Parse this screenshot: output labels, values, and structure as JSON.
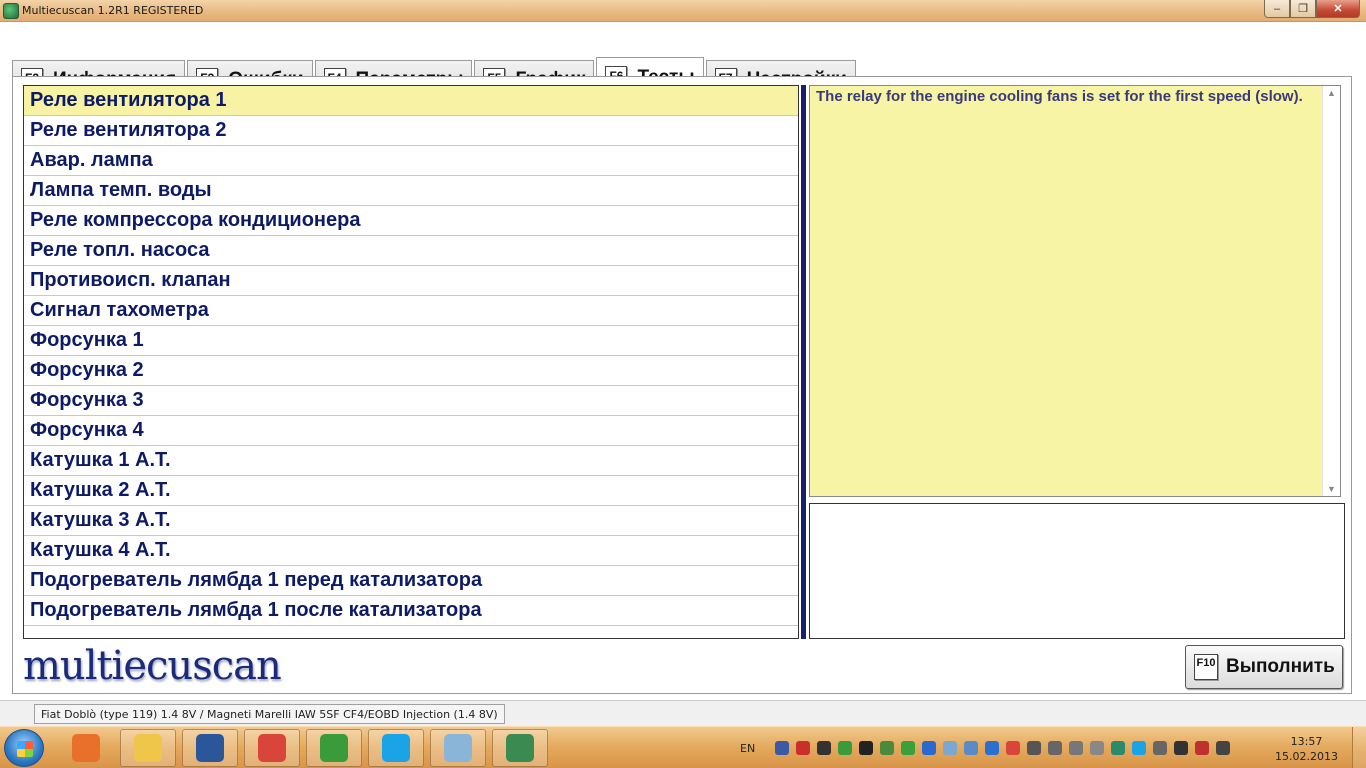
{
  "window": {
    "title": "Multiecuscan 1.2R1 REGISTERED",
    "min_glyph": "–",
    "max_glyph": "❐",
    "close_glyph": "✕"
  },
  "tabs": [
    {
      "fkey": "F2",
      "label": "Информация",
      "active": false
    },
    {
      "fkey": "F3",
      "label": "Ошибки",
      "active": false
    },
    {
      "fkey": "F4",
      "label": "Параметры",
      "active": false
    },
    {
      "fkey": "F5",
      "label": "График",
      "active": false
    },
    {
      "fkey": "F6",
      "label": "Тесты",
      "active": true
    },
    {
      "fkey": "F7",
      "label": "Настройки",
      "active": false
    }
  ],
  "tests": {
    "items": [
      "Реле вентилятора 1",
      "Реле вентилятора 2",
      "Авар. лампа",
      "Лампа темп. воды",
      "Реле компрессора кондиционера",
      "Реле топл. насоса",
      "Противоисп. клапан",
      "Сигнал тахометра",
      "Форсунка 1",
      "Форсунка 2",
      "Форсунка 3",
      "Форсунка 4",
      "Катушка 1 А.Т.",
      "Катушка 2 А.Т.",
      "Катушка 3 А.Т.",
      "Катушка 4 А.Т.",
      "Подогреватель лямбда 1 перед катализатора",
      "Подогреватель лямбда 1 после катализатора"
    ],
    "selected_index": 0
  },
  "description": {
    "text": "The relay for the engine cooling fans is set for the first speed (slow)."
  },
  "brand": "multiecuscan",
  "run_button": {
    "fkey": "F10",
    "label": "Выполнить"
  },
  "status": {
    "vehicle": "Fiat Doblò (type 119) 1.4 8V / Magneti Marelli IAW 5SF CF4/EOBD Injection (1.4 8V)"
  },
  "taskbar": {
    "apps": [
      {
        "name": "media-player-icon",
        "color": "#e8702a"
      },
      {
        "name": "file-explorer-icon",
        "color": "#f0c64a"
      },
      {
        "name": "word-icon",
        "color": "#2b579a"
      },
      {
        "name": "chrome-icon",
        "color": "#d9443b"
      },
      {
        "name": "utorrent-icon",
        "color": "#3a9b3a"
      },
      {
        "name": "skype-icon",
        "color": "#1aa3e6"
      },
      {
        "name": "paint-icon",
        "color": "#8ab4d8"
      },
      {
        "name": "multiecuscan-taskbar-icon",
        "color": "#3a8a52"
      }
    ],
    "language": "EN",
    "tray_icons": [
      "bluetooth-icon",
      "pdf-icon",
      "pen-icon",
      "utorrent-tray-icon",
      "network-monitor-icon",
      "tools-icon",
      "check-icon",
      "update-icon",
      "cloud-icon",
      "browser-icon",
      "shield-icon",
      "chrome-tray-icon",
      "volume-icon",
      "window-icon",
      "battery-icon",
      "mail-icon",
      "antivirus-icon",
      "skype-tray-icon",
      "printer-icon",
      "user-icon",
      "flag-icon",
      "wifi-icon"
    ],
    "time": "13:57",
    "date": "15.02.2013"
  },
  "colors": {
    "selected_row": "#f8f3a4",
    "description_bg": "#f8f4a6",
    "item_text": "#0d1b66",
    "taskbar": "#e4a95c"
  }
}
